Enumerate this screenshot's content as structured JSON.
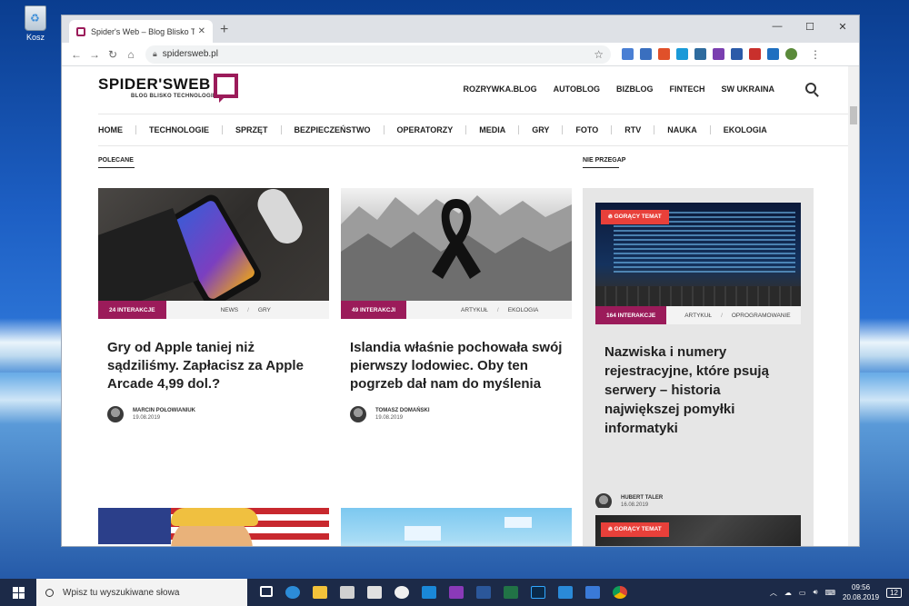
{
  "desktop": {
    "recycle_bin_label": "Kosz"
  },
  "browser": {
    "tab_title": "Spider's Web – Blog Blisko Techno",
    "url": "spidersweb.pl"
  },
  "site": {
    "logo_main": "SPIDER'SWEB",
    "logo_sub": "BLOG BLISKO TECHNOLOGII",
    "top_links": [
      "ROZRYWKA.BLOG",
      "AUTOBLOG",
      "BIZBLOG",
      "FINTECH",
      "SW UKRAINA"
    ],
    "nav": [
      "HOME",
      "TECHNOLOGIE",
      "SPRZĘT",
      "BEZPIECZEŃSTWO",
      "OPERATORZY",
      "MEDIA",
      "GRY",
      "FOTO",
      "RTV",
      "NAUKA",
      "EKOLOGIA"
    ],
    "section_left": "POLECANE",
    "section_right": "NIE PRZEGAP"
  },
  "articles": [
    {
      "interactions": "24 INTERAKCJE",
      "cat1": "NEWS",
      "cat2": "GRY",
      "title": "Gry od Apple taniej niż sądziliśmy. Zapłacisz za Apple Arcade 4,99 dol.?",
      "author": "MARCIN POŁOWIANIUK",
      "date": "19.08.2019"
    },
    {
      "interactions": "49 INTERAKCJI",
      "cat1": "ARTYKUŁ",
      "cat2": "EKOLOGIA",
      "title": "Islandia właśnie pochowała swój pierwszy lodowiec. Oby ten pogrzeb dał nam do myślenia",
      "author": "TOMASZ DOMAŃSKI",
      "date": "19.08.2019"
    }
  ],
  "featured": {
    "hot_label": "GORĄCY TEMAT",
    "interactions": "164 INTERAKCJE",
    "cat1": "ARTYKUŁ",
    "cat2": "OPROGRAMOWANIE",
    "title": "Nazwiska i numery rejestracyjne, które psują serwery – historia największej pomyłki informatyki",
    "author": "HUBERT TALER",
    "date": "16.08.2019",
    "hot_label_2": "GORĄCY TEMAT"
  },
  "taskbar": {
    "search_placeholder": "Wpisz tu wyszukiwane słowa",
    "time": "09:56",
    "date": "20.08.2019",
    "notifications": "12"
  }
}
